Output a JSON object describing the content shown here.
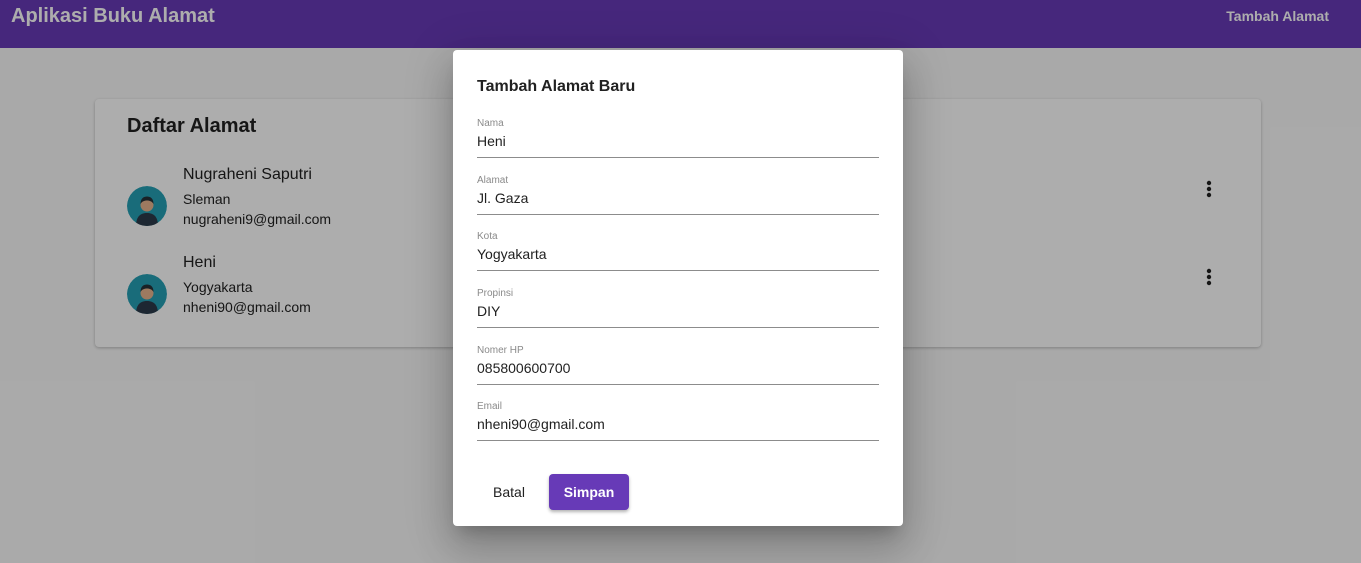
{
  "appbar": {
    "title": "Aplikasi Buku Alamat",
    "action_label": "Tambah Alamat"
  },
  "card": {
    "title": "Daftar Alamat",
    "contacts": [
      {
        "name": "Nugraheni Saputri",
        "city": "Sleman",
        "email": "nugraheni9@gmail.com",
        "avatar_icon": "person-avatar-icon",
        "menu_icon": "more-vert-icon"
      },
      {
        "name": "Heni",
        "city": "Yogyakarta",
        "email": "nheni90@gmail.com",
        "avatar_icon": "person-avatar-icon",
        "menu_icon": "more-vert-icon"
      }
    ]
  },
  "dialog": {
    "title": "Tambah Alamat Baru",
    "fields": [
      {
        "label": "Nama",
        "value": "Heni"
      },
      {
        "label": "Alamat",
        "value": "Jl. Gaza"
      },
      {
        "label": "Kota",
        "value": "Yogyakarta"
      },
      {
        "label": "Propinsi",
        "value": "DIY"
      },
      {
        "label": "Nomer HP",
        "value": "085800600700"
      },
      {
        "label": "Email",
        "value": "nheni90@gmail.com"
      }
    ],
    "cancel_label": "Batal",
    "save_label": "Simpan"
  },
  "colors": {
    "primary": "#673ab7",
    "avatar_bg": "#26a0b4",
    "scrim": "rgba(0,0,0,0.32)"
  }
}
